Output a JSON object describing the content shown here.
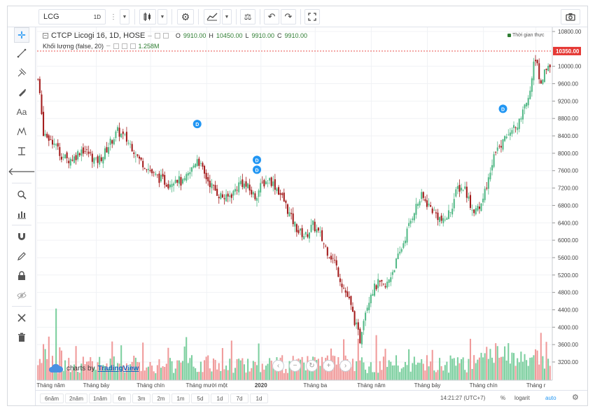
{
  "toolbar": {
    "symbol": "LCG",
    "interval": "1D"
  },
  "legend": {
    "title": "CTCP Licogi 16, 1D, HOSE",
    "o_label": "O",
    "o_val": "9910.00",
    "h_label": "H",
    "h_val": "10450.00",
    "l_label": "L",
    "l_val": "9910.00",
    "c_label": "C",
    "c_val": "9910.00",
    "volume_label": "Khối lượng (false, 20)",
    "volume_val": "1.258M",
    "realtime": "Thời gian thực"
  },
  "watermark": {
    "prefix": "charts by",
    "brand": "TradingView"
  },
  "ranges": [
    "6năm",
    "2năm",
    "1năm",
    "6m",
    "3m",
    "2m",
    "1m",
    "5d",
    "1d",
    "7d",
    "1d"
  ],
  "status": {
    "time": "14:21:27 (UTC+7)",
    "pct": "%",
    "log": "logarit",
    "auto": "auto"
  },
  "colors": {
    "up": "#53b987",
    "down": "#a31c1c",
    "vol_up": "#7ccf9f",
    "vol_down": "#f09a9a",
    "marker": "#2196f3",
    "price_tag": "#e53935"
  },
  "chart_data": {
    "type": "candlestick",
    "y_ticks": [
      "10800.00",
      "10000.00",
      "9600.00",
      "9200.00",
      "8800.00",
      "8400.00",
      "8000.00",
      "7600.00",
      "7200.00",
      "6800.00",
      "6400.00",
      "6000.00",
      "5600.00",
      "5200.00",
      "4800.00",
      "4400.00",
      "4000.00",
      "3600.00",
      "3200.00"
    ],
    "y_tick_values": [
      10800,
      10000,
      9600,
      9200,
      8800,
      8400,
      8000,
      7600,
      7200,
      6800,
      6400,
      6000,
      5600,
      5200,
      4800,
      4400,
      4000,
      3600,
      3200
    ],
    "x_ticks": [
      "Tháng năm",
      "Tháng bảy",
      "Tháng chín",
      "Tháng mười một",
      "2020",
      "Tháng ba",
      "Tháng năm",
      "Tháng bảy",
      "Tháng chín",
      "Tháng r"
    ],
    "last_price": "10350.00",
    "last_price_value": 10350,
    "markers": [
      {
        "label": "D",
        "index": 88
      },
      {
        "label": "D",
        "index": 121
      },
      {
        "label": "D",
        "index": 121
      },
      {
        "label": "D",
        "index": 257
      }
    ],
    "close_path": [
      [
        0,
        9700
      ],
      [
        3,
        8500
      ],
      [
        8,
        8300
      ],
      [
        12,
        8000
      ],
      [
        16,
        7850
      ],
      [
        20,
        7900
      ],
      [
        24,
        8100
      ],
      [
        28,
        8000
      ],
      [
        32,
        7800
      ],
      [
        36,
        7950
      ],
      [
        40,
        8250
      ],
      [
        44,
        8500
      ],
      [
        48,
        8350
      ],
      [
        52,
        8150
      ],
      [
        56,
        7850
      ],
      [
        60,
        7700
      ],
      [
        64,
        7500
      ],
      [
        68,
        7400
      ],
      [
        72,
        7300
      ],
      [
        76,
        7450
      ],
      [
        80,
        7300
      ],
      [
        84,
        7550
      ],
      [
        88,
        7900
      ],
      [
        92,
        7500
      ],
      [
        96,
        7250
      ],
      [
        100,
        7050
      ],
      [
        104,
        6950
      ],
      [
        108,
        7100
      ],
      [
        112,
        7350
      ],
      [
        116,
        7200
      ],
      [
        120,
        7000
      ],
      [
        124,
        7300
      ],
      [
        128,
        7400
      ],
      [
        132,
        7200
      ],
      [
        136,
        6900
      ],
      [
        140,
        6500
      ],
      [
        144,
        6200
      ],
      [
        148,
        6100
      ],
      [
        152,
        6350
      ],
      [
        156,
        6100
      ],
      [
        160,
        5750
      ],
      [
        164,
        5500
      ],
      [
        168,
        5000
      ],
      [
        172,
        4600
      ],
      [
        176,
        4000
      ],
      [
        178,
        3700
      ],
      [
        180,
        4250
      ],
      [
        184,
        4800
      ],
      [
        188,
        5000
      ],
      [
        192,
        4900
      ],
      [
        196,
        5300
      ],
      [
        200,
        5700
      ],
      [
        204,
        6200
      ],
      [
        208,
        6700
      ],
      [
        212,
        7000
      ],
      [
        216,
        6800
      ],
      [
        220,
        6600
      ],
      [
        224,
        6400
      ],
      [
        228,
        6700
      ],
      [
        232,
        7200
      ],
      [
        236,
        7200
      ],
      [
        240,
        6700
      ],
      [
        244,
        6700
      ],
      [
        248,
        7200
      ],
      [
        252,
        8000
      ],
      [
        256,
        8200
      ],
      [
        260,
        8400
      ],
      [
        264,
        8600
      ],
      [
        268,
        8900
      ],
      [
        272,
        9500
      ],
      [
        274,
        10100
      ],
      [
        276,
        10000
      ],
      [
        278,
        9600
      ],
      [
        280,
        9900
      ],
      [
        282,
        10050
      ]
    ]
  }
}
